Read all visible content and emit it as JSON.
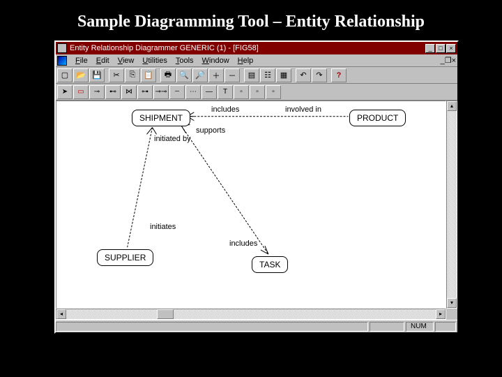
{
  "slide": {
    "title": "Sample Diagramming Tool – Entity Relationship"
  },
  "window": {
    "title": "Entity Relationship Diagrammer GENERIC (1) - [FIG58]",
    "buttons": {
      "min": "_",
      "max": "□",
      "close": "×",
      "restore": "❐"
    }
  },
  "menu": {
    "items": [
      {
        "label": "File",
        "u": "F"
      },
      {
        "label": "Edit",
        "u": "E"
      },
      {
        "label": "View",
        "u": "V"
      },
      {
        "label": "Utilities",
        "u": "U"
      },
      {
        "label": "Tools",
        "u": "T"
      },
      {
        "label": "Window",
        "u": "W"
      },
      {
        "label": "Help",
        "u": "H"
      }
    ]
  },
  "toolbar": {
    "icons": [
      "new",
      "open",
      "save",
      "sep",
      "cut",
      "copy",
      "paste",
      "sep",
      "print",
      "preview",
      "find",
      "zoom-in",
      "zoom-out",
      "sep",
      "props",
      "tree",
      "table",
      "sep",
      "undo",
      "redo",
      "sep",
      "help"
    ]
  },
  "palette": {
    "icons": [
      "pointer",
      "entity",
      "rel-1n",
      "rel-11",
      "rel-nm",
      "rel-opt",
      "rel-id",
      "rel-dash",
      "rel-dot",
      "rel-many",
      "text",
      "sep",
      "layer1",
      "layer2",
      "layer3"
    ]
  },
  "entities": {
    "shipment": "SHIPMENT",
    "product": "PRODUCT",
    "supplier": "SUPPLIER",
    "task": "TASK"
  },
  "relations": {
    "includes1": "includes",
    "involved_in": "involved in",
    "supports": "supports",
    "initiated_by": "initiated by",
    "initiates": "initiates",
    "includes2": "includes"
  },
  "status": {
    "num": "NUM"
  }
}
